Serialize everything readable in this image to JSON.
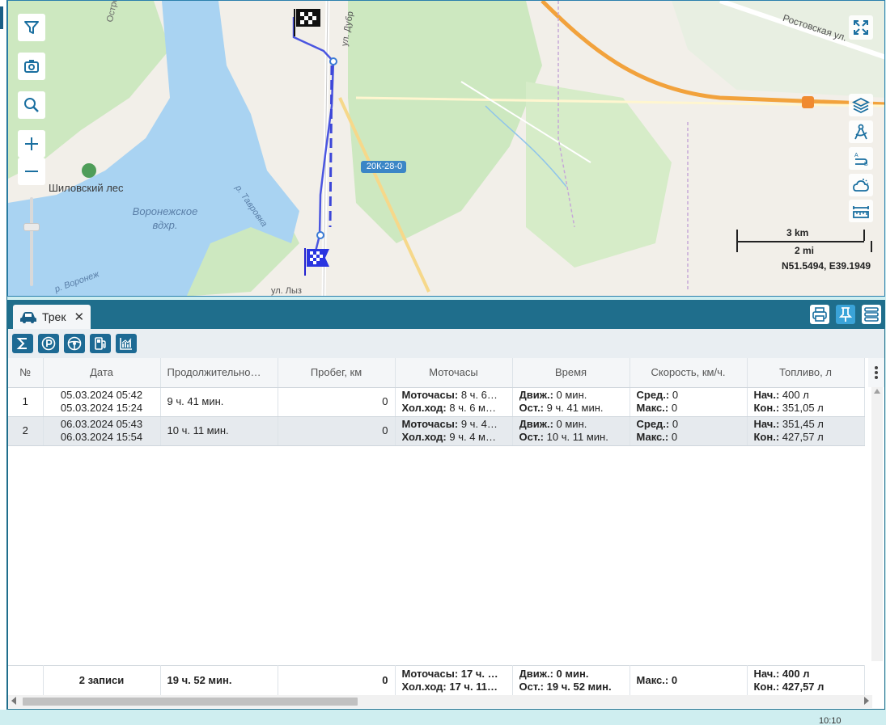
{
  "map": {
    "labels": {
      "ostrogozhskaya": "Острогожская ул.",
      "shilovsky": "Шиловский лес",
      "reservoir": "Воронежское вдхр.",
      "tavrovka": "р. Тавровка",
      "voronezh_river": "р. Воронеж",
      "dubr": "ул. Дубр",
      "lyz": "ул. Лыз",
      "rostovskaya": "Ростовская ул.",
      "road": "20К-28-0"
    },
    "scale_km": "3 km",
    "scale_mi": "2 mi",
    "coords": "N51.5494, E39.1949",
    "icons": [
      "filter-icon",
      "camera-icon",
      "search-icon",
      "zoom-in-icon",
      "zoom-out-icon",
      "fullscreen-icon",
      "layers-icon",
      "measure-icon",
      "route-icon",
      "weather-icon",
      "ruler-icon"
    ],
    "colors": {
      "track": "#4a55e0",
      "water": "#a9d3f2",
      "forest": "#cde8c0",
      "road_main": "#f2a23c",
      "border": "#2b80ad"
    }
  },
  "panel": {
    "tab_label": "Трек",
    "tab_close": "✕",
    "toolbar_icons": [
      "sum-icon",
      "parking-icon",
      "steering-wheel-icon",
      "fuel-icon",
      "chart-icon"
    ]
  },
  "table": {
    "headers": [
      "№",
      "Дата",
      "Продолжительно…",
      "Пробег, км",
      "Моточасы",
      "Время",
      "Скорость, км/ч.",
      "Топливо, л"
    ],
    "rows": [
      {
        "num": "1",
        "date_start": "05.03.2024 05:42",
        "date_end": "05.03.2024 15:24",
        "duration": "9 ч. 41 мин.",
        "mileage": "0",
        "moto_label": "Моточасы:",
        "moto_value": "8 ч. 6…",
        "idle_label": "Хол.ход:",
        "idle_value": "8 ч. 6 м…",
        "move_label": "Движ.:",
        "move_value": "0 мин.",
        "stop_label": "Ост.:",
        "stop_value": "9 ч. 41 мин.",
        "avg_label": "Сред.:",
        "avg_value": "0",
        "max_label": "Макс.:",
        "max_value": "0",
        "fuel_start_label": "Нач.:",
        "fuel_start_value": "400 л",
        "fuel_end_label": "Кон.:",
        "fuel_end_value": "351,05 л"
      },
      {
        "num": "2",
        "date_start": "06.03.2024 05:43",
        "date_end": "06.03.2024 15:54",
        "duration": "10 ч. 11 мин.",
        "mileage": "0",
        "moto_label": "Моточасы:",
        "moto_value": "9 ч. 4…",
        "idle_label": "Хол.ход:",
        "idle_value": "9 ч. 4 м…",
        "move_label": "Движ.:",
        "move_value": "0 мин.",
        "stop_label": "Ост.:",
        "stop_value": "10 ч. 11 мин.",
        "avg_label": "Сред.:",
        "avg_value": "0",
        "max_label": "Макс.:",
        "max_value": "0",
        "fuel_start_label": "Нач.:",
        "fuel_start_value": "351,45 л",
        "fuel_end_label": "Кон.:",
        "fuel_end_value": "427,57 л"
      }
    ],
    "footer": {
      "count": "2 записи",
      "duration": "19 ч. 52 мин.",
      "mileage": "0",
      "moto": "Моточасы: 17 ч. …",
      "idle": "Хол.ход: 17 ч. 11…",
      "move": "Движ.: 0 мин.",
      "stop": "Ост.: 19 ч. 52 мин.",
      "max": "Макс.: 0",
      "fuel_start": "Нач.: 400 л",
      "fuel_end": "Кон.: 427,57 л"
    }
  },
  "taskbar": {
    "time": "10:10"
  }
}
